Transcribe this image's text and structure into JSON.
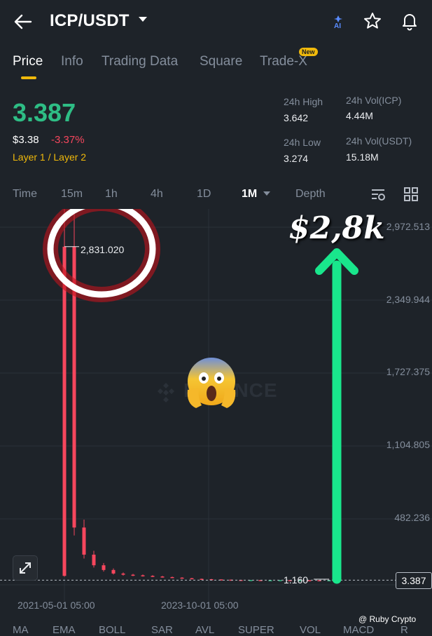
{
  "header": {
    "pair": "ICP/USDT",
    "ai_label": "AI"
  },
  "tabs": [
    {
      "label": "Price",
      "active": true
    },
    {
      "label": "Info"
    },
    {
      "label": "Trading Data"
    },
    {
      "label": "Square"
    },
    {
      "label": "Trade-X"
    }
  ],
  "new_badge": "New",
  "price": {
    "last": "3.387",
    "usd": "$3.38",
    "change": "-3.37%",
    "tags": "Layer 1 / Layer 2"
  },
  "stats": {
    "high_label": "24h High",
    "high_value": "3.642",
    "vol_icp_label": "24h Vol(ICP)",
    "vol_icp_value": "4.44M",
    "low_label": "24h Low",
    "low_value": "3.274",
    "vol_usdt_label": "24h Vol(USDT)",
    "vol_usdt_value": "15.18M"
  },
  "intervals": [
    {
      "label": "Time"
    },
    {
      "label": "15m"
    },
    {
      "label": "1h"
    },
    {
      "label": "4h"
    },
    {
      "label": "1D"
    },
    {
      "label": "1M",
      "active": true
    },
    {
      "label": "Depth"
    }
  ],
  "chart_data": {
    "type": "candlestick",
    "y_ticks": [
      "2,972.513",
      "2,349.944",
      "1,727.375",
      "1,104.805",
      "482.236"
    ],
    "x_ticks": [
      "2021-05-01 05:00",
      "2023-10-01 05:00"
    ],
    "max_label": "2,831.020",
    "min_label": "1.160",
    "current_price": "3.387",
    "ylim": [
      0,
      3100
    ],
    "series": [
      2831.02,
      450,
      220,
      130,
      90,
      60,
      50,
      45,
      40,
      35,
      30,
      25,
      20,
      15,
      12,
      10,
      8,
      6,
      5,
      5,
      4,
      4,
      4,
      3.5,
      3.5,
      3.4,
      3.3,
      3.387
    ]
  },
  "annotation": "$2,8k",
  "watermark": "BINANCE",
  "credit": "@ Ruby Crypto",
  "indicators": [
    "MA",
    "EMA",
    "BOLL",
    "SAR",
    "AVL",
    "SUPER",
    "VOL",
    "MACD",
    "R"
  ],
  "colors": {
    "up": "#2ebd85",
    "down": "#f6465d",
    "accent": "#f0b90b",
    "arrow": "#19e68c",
    "circle_glow": "#c0121c"
  }
}
